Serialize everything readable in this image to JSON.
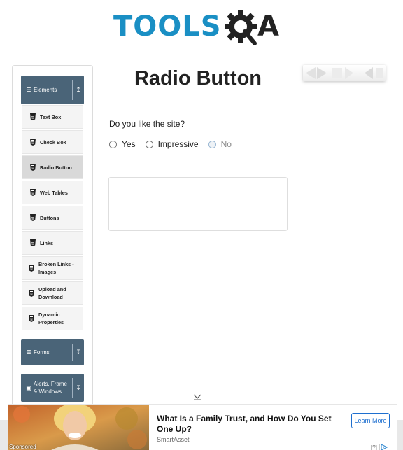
{
  "header": {
    "logo_text": "TOOLS",
    "logo_suffix": "A"
  },
  "sidebar": {
    "elements_group": {
      "label": "Elements",
      "icon": "list-icon",
      "arrow": "collapse-arrow-icon"
    },
    "items": [
      {
        "label": "Text Box",
        "icon": "html5-icon"
      },
      {
        "label": "Check Box",
        "icon": "html5-icon"
      },
      {
        "label": "Radio Button",
        "icon": "html5-icon",
        "active": true
      },
      {
        "label": "Web Tables",
        "icon": "html5-icon"
      },
      {
        "label": "Buttons",
        "icon": "html5-icon"
      },
      {
        "label": "Links",
        "icon": "html5-icon"
      },
      {
        "label": "Broken Links - Images",
        "icon": "html5-icon"
      },
      {
        "label": "Upload and Download",
        "icon": "html5-icon"
      },
      {
        "label": "Dynamic Properties",
        "icon": "html5-icon"
      }
    ],
    "forms_group": {
      "label": "Forms",
      "icon": "list-icon",
      "arrow": "expand-arrow-icon"
    },
    "alerts_group": {
      "label": "Alerts, Frame & Windows",
      "icon": "window-icon",
      "arrow": "expand-arrow-icon"
    }
  },
  "main": {
    "title": "Radio Button",
    "question": "Do you like the site?",
    "options": [
      {
        "label": "Yes",
        "checked": false,
        "disabled": false
      },
      {
        "label": "Impressive",
        "checked": false,
        "disabled": false
      },
      {
        "label": "No",
        "checked": false,
        "disabled": true
      }
    ]
  },
  "bottom_ad": {
    "sponsored": "Sponsored",
    "headline": "What Is a Family Trust, and How Do You Set One Up?",
    "source": "SmartAsset",
    "cta": "Learn More",
    "choices": "[?]"
  },
  "colors": {
    "logo_blue": "#1a8fc4",
    "sidebar_header": "#4a6478",
    "active_item": "#d9d9d9",
    "cta_blue": "#1e6fcf"
  }
}
